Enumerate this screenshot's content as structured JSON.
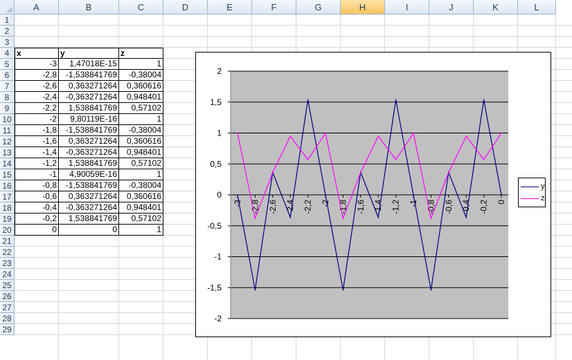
{
  "columns": [
    "A",
    "B",
    "C",
    "D",
    "E",
    "F",
    "G",
    "H",
    "I",
    "J",
    "K",
    "L"
  ],
  "active_column": "H",
  "rows": [
    "1",
    "2",
    "3",
    "4",
    "5",
    "6",
    "7",
    "8",
    "9",
    "10",
    "11",
    "12",
    "13",
    "14",
    "15",
    "16",
    "17",
    "18",
    "19",
    "20",
    "21",
    "22",
    "23",
    "24",
    "25",
    "26",
    "27",
    "28",
    "29"
  ],
  "table": {
    "headers": [
      "x",
      "y",
      "z"
    ],
    "rows": [
      [
        "-3",
        "1,47018E-15",
        "1"
      ],
      [
        "-2,8",
        "-1,538841769",
        "-0,38004"
      ],
      [
        "-2,6",
        "0,363271264",
        "0,360616"
      ],
      [
        "-2,4",
        "-0,363271264",
        "0,948401"
      ],
      [
        "-2,2",
        "1,538841769",
        "0,57102"
      ],
      [
        "-2",
        "9,80119E-16",
        "1"
      ],
      [
        "-1,8",
        "-1,538841769",
        "-0,38004"
      ],
      [
        "-1,6",
        "0,363271264",
        "0,360616"
      ],
      [
        "-1,4",
        "-0,363271264",
        "0,948401"
      ],
      [
        "-1,2",
        "1,538841769",
        "0,57102"
      ],
      [
        "-1",
        "4,90059E-16",
        "1"
      ],
      [
        "-0,8",
        "-1,538841769",
        "-0,38004"
      ],
      [
        "-0,6",
        "0,363271264",
        "0,360616"
      ],
      [
        "-0,4",
        "-0,363271264",
        "0,948401"
      ],
      [
        "-0,2",
        "1,538841769",
        "0,57102"
      ],
      [
        "0",
        "0",
        "1"
      ]
    ]
  },
  "chart_data": {
    "type": "line",
    "categories": [
      "-3",
      "-2,8",
      "-2,6",
      "-2,4",
      "-2,2",
      "-2",
      "-1,8",
      "-1,6",
      "-1,4",
      "-1,2",
      "-1",
      "-0,8",
      "-0,6",
      "-0,4",
      "-0,2",
      "0"
    ],
    "series": [
      {
        "name": "y",
        "color": "#000080",
        "values": [
          0,
          -1.538841769,
          0.363271264,
          -0.363271264,
          1.538841769,
          0,
          -1.538841769,
          0.363271264,
          -0.363271264,
          1.538841769,
          0,
          -1.538841769,
          0.363271264,
          -0.363271264,
          1.538841769,
          0
        ]
      },
      {
        "name": "z",
        "color": "#ff00ff",
        "values": [
          1,
          -0.38004,
          0.360616,
          0.948401,
          0.57102,
          1,
          -0.38004,
          0.360616,
          0.948401,
          0.57102,
          1,
          -0.38004,
          0.360616,
          0.948401,
          0.57102,
          1
        ]
      }
    ],
    "y_ticks": [
      "2",
      "1,5",
      "1",
      "0,5",
      "0",
      "-0,5",
      "-1",
      "-1,5",
      "-2"
    ],
    "ylim": [
      -2,
      2
    ],
    "grid": true,
    "plot_background": "#c0c0c0",
    "legend_position": "right"
  }
}
